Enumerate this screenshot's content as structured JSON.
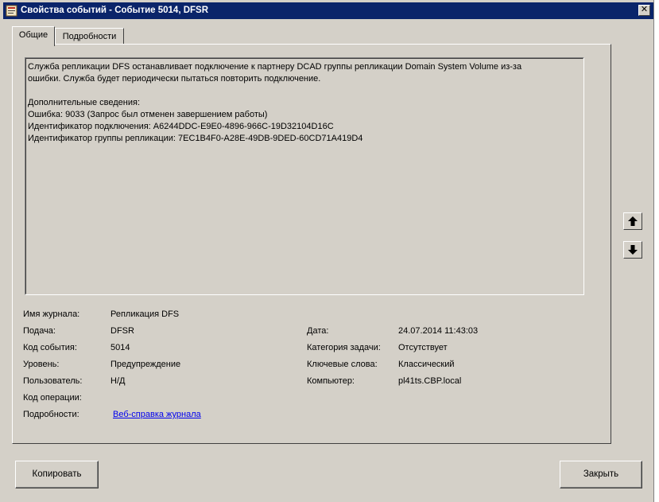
{
  "window": {
    "title": "Свойства событий - Событие 5014, DFSR",
    "close_glyph": "✕"
  },
  "tabs": [
    {
      "label": "Общие"
    },
    {
      "label": "Подробности"
    }
  ],
  "description": {
    "lines": [
      "Служба репликации DFS останавливает подключение к партнеру DCAD  группы репликации Domain System Volume из-за",
      "ошибки. Служба будет периодически пытаться повторить подключение.",
      "",
      "Дополнительные сведения:",
      "Ошибка: 9033 (Запрос был отменен завершением работы)",
      "Идентификатор подключения: A6244DDC-E9E0-4896-966C-19D32104D16C",
      "Идентификатор группы репликации: 7EC1B4F0-A28E-49DB-9DED-60CD71A419D4"
    ]
  },
  "fields_left": [
    {
      "label": "Имя журнала:",
      "value": "Репликация DFS"
    },
    {
      "label": "Подача:",
      "value": "DFSR"
    },
    {
      "label": "Код события:",
      "value": "5014"
    },
    {
      "label": "Уровень:",
      "value": "Предупреждение"
    },
    {
      "label": "Пользователь:",
      "value": "Н/Д"
    },
    {
      "label": "Код операции:",
      "value": ""
    },
    {
      "label": "Подробности:",
      "value": "Веб-справка журнала"
    }
  ],
  "fields_right": [
    {
      "label": "Дата:",
      "value": "24.07.2014 11:43:03"
    },
    {
      "label": "Категория задачи:",
      "value": "Отсутствует"
    },
    {
      "label": "Ключевые слова:",
      "value": "Классический"
    },
    {
      "label": "Компьютер:",
      "value": "pl41ts.CBP.local"
    }
  ],
  "nav": {
    "up_glyph": "🡅",
    "down_glyph": "🡇"
  },
  "buttons": {
    "copy": "Копировать",
    "close": "Закрыть"
  },
  "colors": {
    "titlebar": "#0a246a",
    "face": "#d4d0c8",
    "link": "#0000ee"
  }
}
